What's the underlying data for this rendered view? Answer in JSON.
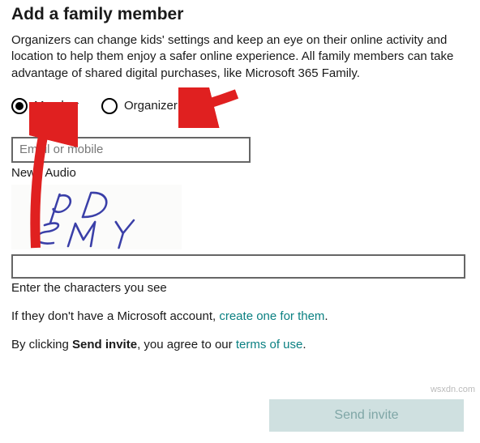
{
  "heading": "Add a family member",
  "description": "Organizers can change kids' settings and keep an eye on their online activity and location to help them enjoy a safer online experience. All family members can take advantage of shared digital purchases, like Microsoft 365 Family.",
  "role": {
    "member_label": "Member",
    "organizer_label": "Organizer",
    "selected": "member"
  },
  "email_input": {
    "placeholder": "Email or mobile",
    "value": ""
  },
  "captcha": {
    "new_label": "New",
    "audio_label": "Audio",
    "separator": " | ",
    "text": "pD SMY",
    "input_value": "",
    "caption": "Enter the characters you see"
  },
  "no_account": {
    "prefix": "If they don't have a Microsoft account, ",
    "link": "create one for them",
    "suffix": "."
  },
  "terms": {
    "prefix": "By clicking ",
    "bold": "Send invite",
    "middle": ", you agree to our ",
    "link": "terms of use",
    "suffix": "."
  },
  "send_button_label": "Send invite",
  "watermark": "wsxdn.com",
  "colors": {
    "link": "#0b8082",
    "button_bg": "#cfe0e0",
    "button_text": "#7fa6a6",
    "arrow": "#e02020"
  }
}
